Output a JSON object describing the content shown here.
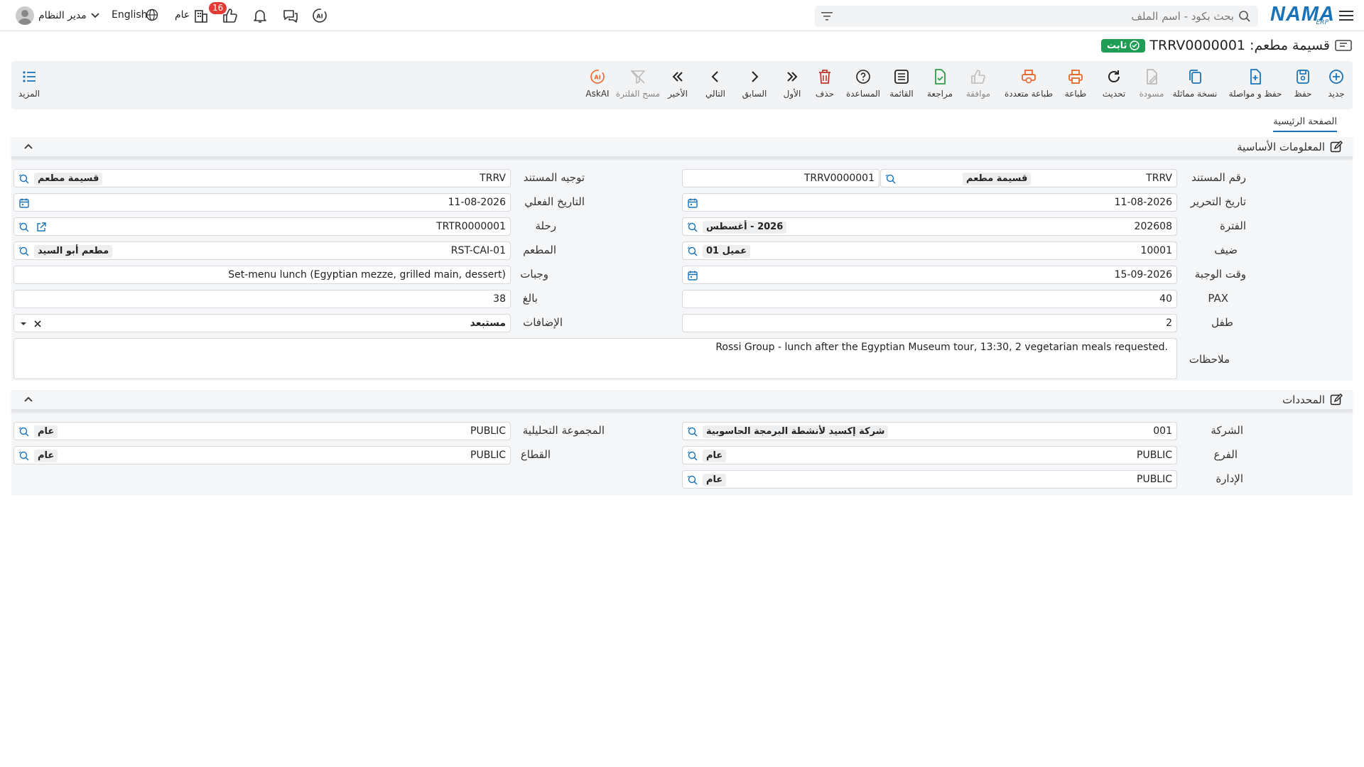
{
  "header": {
    "logo_text": "NAMA",
    "logo_sub": "ERP",
    "search_placeholder": "بحث بكود - اسم الملف",
    "notification_count": "16",
    "scope_label": "عام",
    "language_label": "English",
    "user_name": "مدير النظام"
  },
  "page": {
    "title": "قسيمة مطعم: TRRV0000001",
    "status": "ثابت"
  },
  "toolbar": {
    "new": "جديد",
    "save": "حفظ",
    "save_continue": "حفظ و مواصلة",
    "duplicate": "نسخة مماثلة",
    "draft": "مسودة",
    "refresh": "تحديث",
    "print": "طباعة",
    "multi_print": "طباعة متعددة",
    "approve": "موافقة",
    "review": "مراجعة",
    "list": "القائمة",
    "help": "المساعدة",
    "delete": "حذف",
    "first": "الأول",
    "previous": "السابق",
    "next": "التالي",
    "last": "الأخير",
    "clear_filter": "مسح الفلترة",
    "ask_ai": "AskAI",
    "more": "المزيد"
  },
  "tabs": {
    "main": "الصفحة الرئيسية"
  },
  "basic": {
    "title": "المعلومات الأساسية",
    "doc_number_label": "رقم المستند",
    "doc_number_prefix": "TRRV",
    "doc_number_type": "قسيمة مطعم",
    "doc_number_value": "TRRV0000001",
    "doc_direction_label": "توجيه المستند",
    "doc_direction_value": "TRRV",
    "doc_direction_tag": "قسيمة مطعم",
    "edit_date_label": "تاريخ التحرير",
    "edit_date_value": "11-08-2026",
    "actual_date_label": "التاريخ الفعلي",
    "actual_date_value": "11-08-2026",
    "period_label": "الفترة",
    "period_value": "202608",
    "period_tag": "2026 - أغسطس",
    "trip_label": "رحلة",
    "trip_value": "TRTR0000001",
    "guest_label": "ضيف",
    "guest_value": "10001",
    "guest_tag": "عميل 01",
    "restaurant_label": "المطعم",
    "restaurant_value": "RST-CAI-01",
    "restaurant_tag": "مطعم أبو السيد",
    "meal_time_label": "وقت الوجبة",
    "meal_time_value": "15-09-2026",
    "meals_label": "وجبات",
    "meals_value": "Set-menu lunch (Egyptian mezze, grilled main, dessert)",
    "pax_label": "PAX",
    "pax_value": "40",
    "adult_label": "بالغ",
    "adult_value": "38",
    "child_label": "طفل",
    "child_value": "2",
    "extras_label": "الإضافات",
    "extras_value": "مستبعد",
    "notes_label": "ملاحظات",
    "notes_value": "Rossi Group - lunch after the Egyptian Museum tour, 13:30, 2 vegetarian meals requested."
  },
  "dimensions": {
    "title": "المحددات",
    "company_label": "الشركة",
    "company_value": "001",
    "company_tag": "شركة إكسيد لأنشطة البرمجة الحاسوبية",
    "analytic_label": "المجموعة التحليلية",
    "analytic_value": "PUBLIC",
    "analytic_tag": "عام",
    "branch_label": "الفرع",
    "branch_value": "PUBLIC",
    "branch_tag": "عام",
    "sector_label": "القطاع",
    "sector_value": "PUBLIC",
    "sector_tag": "عام",
    "department_label": "الإدارة",
    "department_value": "PUBLIC",
    "department_tag": "عام"
  },
  "colors": {
    "brand": "#1a73b8",
    "status_green": "#1f9d55",
    "badge_red": "#e53935"
  }
}
